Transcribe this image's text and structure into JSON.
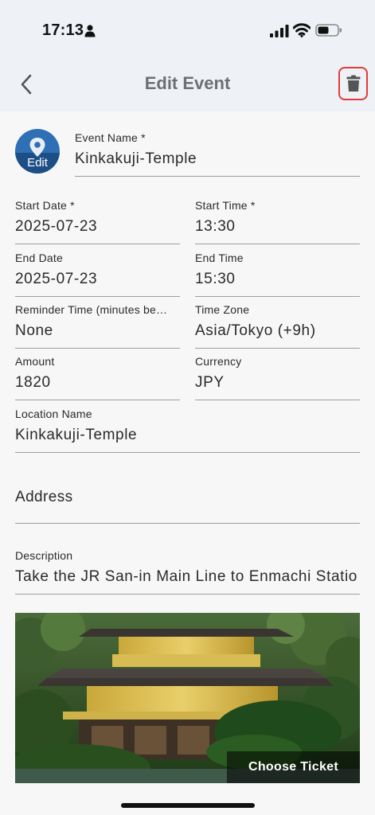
{
  "status_bar": {
    "time": "17:13"
  },
  "app_bar": {
    "title": "Edit Event"
  },
  "avatar": {
    "label": "Edit"
  },
  "event_name": {
    "label": "Event Name *",
    "value": "Kinkakuji-Temple"
  },
  "start_date": {
    "label": "Start Date *",
    "value": "2025-07-23"
  },
  "start_time": {
    "label": "Start Time *",
    "value": "13:30"
  },
  "end_date": {
    "label": "End Date",
    "value": "2025-07-23"
  },
  "end_time": {
    "label": "End Time",
    "value": "15:30"
  },
  "reminder_time": {
    "label": "Reminder Time (minutes be…",
    "value": "None"
  },
  "time_zone": {
    "label": "Time Zone",
    "value": "Asia/Tokyo (+9h)"
  },
  "amount": {
    "label": "Amount",
    "value": "1820"
  },
  "currency": {
    "label": "Currency",
    "value": "JPY"
  },
  "location_name": {
    "label": "Location Name",
    "value": "Kinkakuji-Temple"
  },
  "address": {
    "label": "Address",
    "value": ""
  },
  "description": {
    "label": "Description",
    "value": "Take the JR San-in Main Line to Enmachi Statio"
  },
  "photo": {
    "button_label": "Choose Ticket"
  },
  "colors": {
    "trash_highlight": "#e23b3b",
    "avatar_blue": "#2f6fb5",
    "app_bar_bg": "#eef2f6"
  }
}
